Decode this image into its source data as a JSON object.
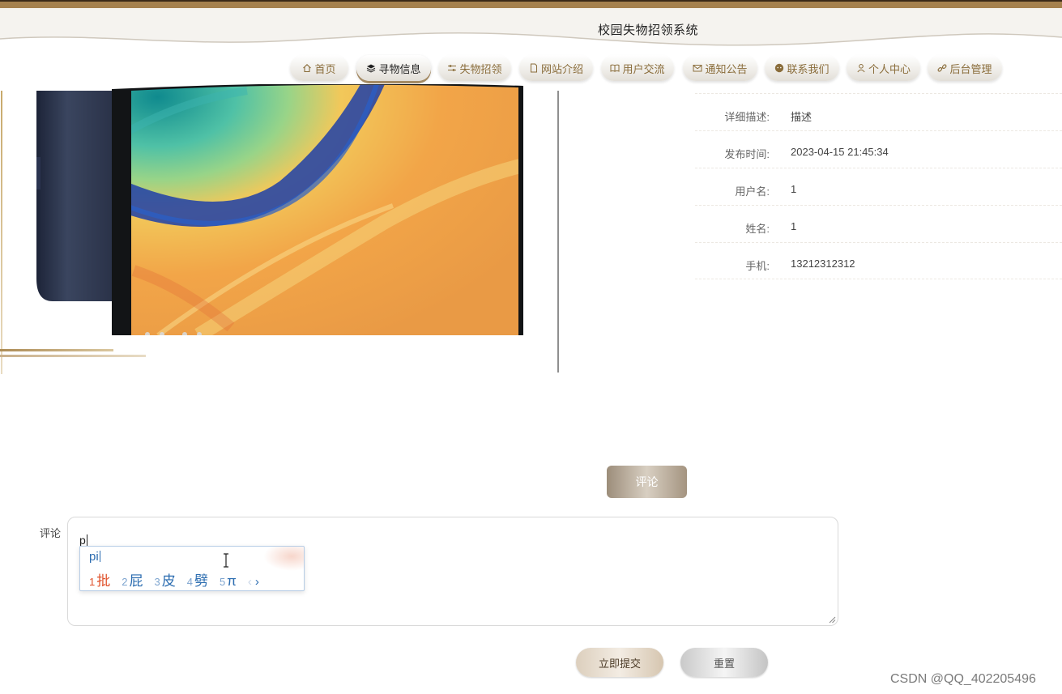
{
  "header": {
    "title": "校园失物招领系统"
  },
  "nav": {
    "items": [
      {
        "label": "首页",
        "icon": "home-icon"
      },
      {
        "label": "寻物信息",
        "icon": "layers-icon",
        "active": true
      },
      {
        "label": "失物招领",
        "icon": "sliders-icon"
      },
      {
        "label": "网站介绍",
        "icon": "document-icon"
      },
      {
        "label": "用户交流",
        "icon": "book-icon"
      },
      {
        "label": "通知公告",
        "icon": "mail-icon"
      },
      {
        "label": "联系我们",
        "icon": "chat-icon"
      },
      {
        "label": "个人中心",
        "icon": "user-icon"
      },
      {
        "label": "后台管理",
        "icon": "link-icon"
      }
    ]
  },
  "details": [
    {
      "label": "详细描述:",
      "value": "描述"
    },
    {
      "label": "发布时间:",
      "value": "2023-04-15 21:45:34"
    },
    {
      "label": "用户名:",
      "value": "1"
    },
    {
      "label": "姓名:",
      "value": "1"
    },
    {
      "label": "手机:",
      "value": "13212312312"
    }
  ],
  "comment": {
    "button_label": "评论",
    "field_label": "评论",
    "value": "p"
  },
  "ime": {
    "input": "pi",
    "candidates": [
      {
        "num": "1",
        "text": "批"
      },
      {
        "num": "2",
        "text": "屁"
      },
      {
        "num": "3",
        "text": "皮"
      },
      {
        "num": "4",
        "text": "劈"
      },
      {
        "num": "5",
        "text": "π"
      }
    ],
    "prev_symbol": "‹",
    "next_symbol": "›"
  },
  "actions": {
    "submit_label": "立即提交",
    "reset_label": "重置"
  },
  "watermark": "CSDN @QQ_402205496",
  "colors": {
    "brand_brown": "#a5814e",
    "nav_text": "#8a6d3b",
    "ime_blue": "#2b6cb0",
    "ime_first": "#e0522c"
  }
}
